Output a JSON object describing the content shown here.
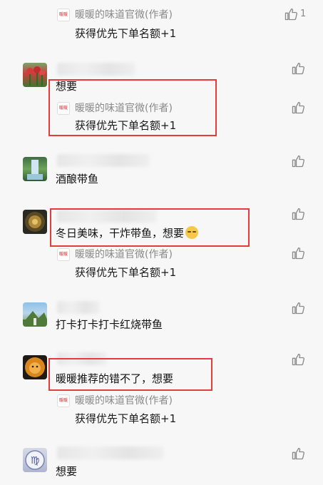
{
  "author": {
    "name": "暖暖的味道官微(作者)",
    "logo_text": "暖暖"
  },
  "reply_text": "获得优先下单名额+1",
  "top_reply": {
    "likes": "1"
  },
  "comments": [
    {
      "text": "想要"
    },
    {
      "text": "酒酿带鱼"
    },
    {
      "text": "冬日美味，干炸带鱼，想要"
    },
    {
      "text": "打卡打卡打卡红烧带鱼"
    },
    {
      "text": "暖暖推荐的错不了，想要"
    },
    {
      "text": "想要"
    }
  ],
  "colors": {
    "highlight_box": "#e53b3b",
    "background": "#f7f7f7",
    "muted_text": "#8a8a8a"
  },
  "icons": {
    "like": "thumbs-up-icon",
    "emoji": "embarrassed-face-emoji"
  }
}
